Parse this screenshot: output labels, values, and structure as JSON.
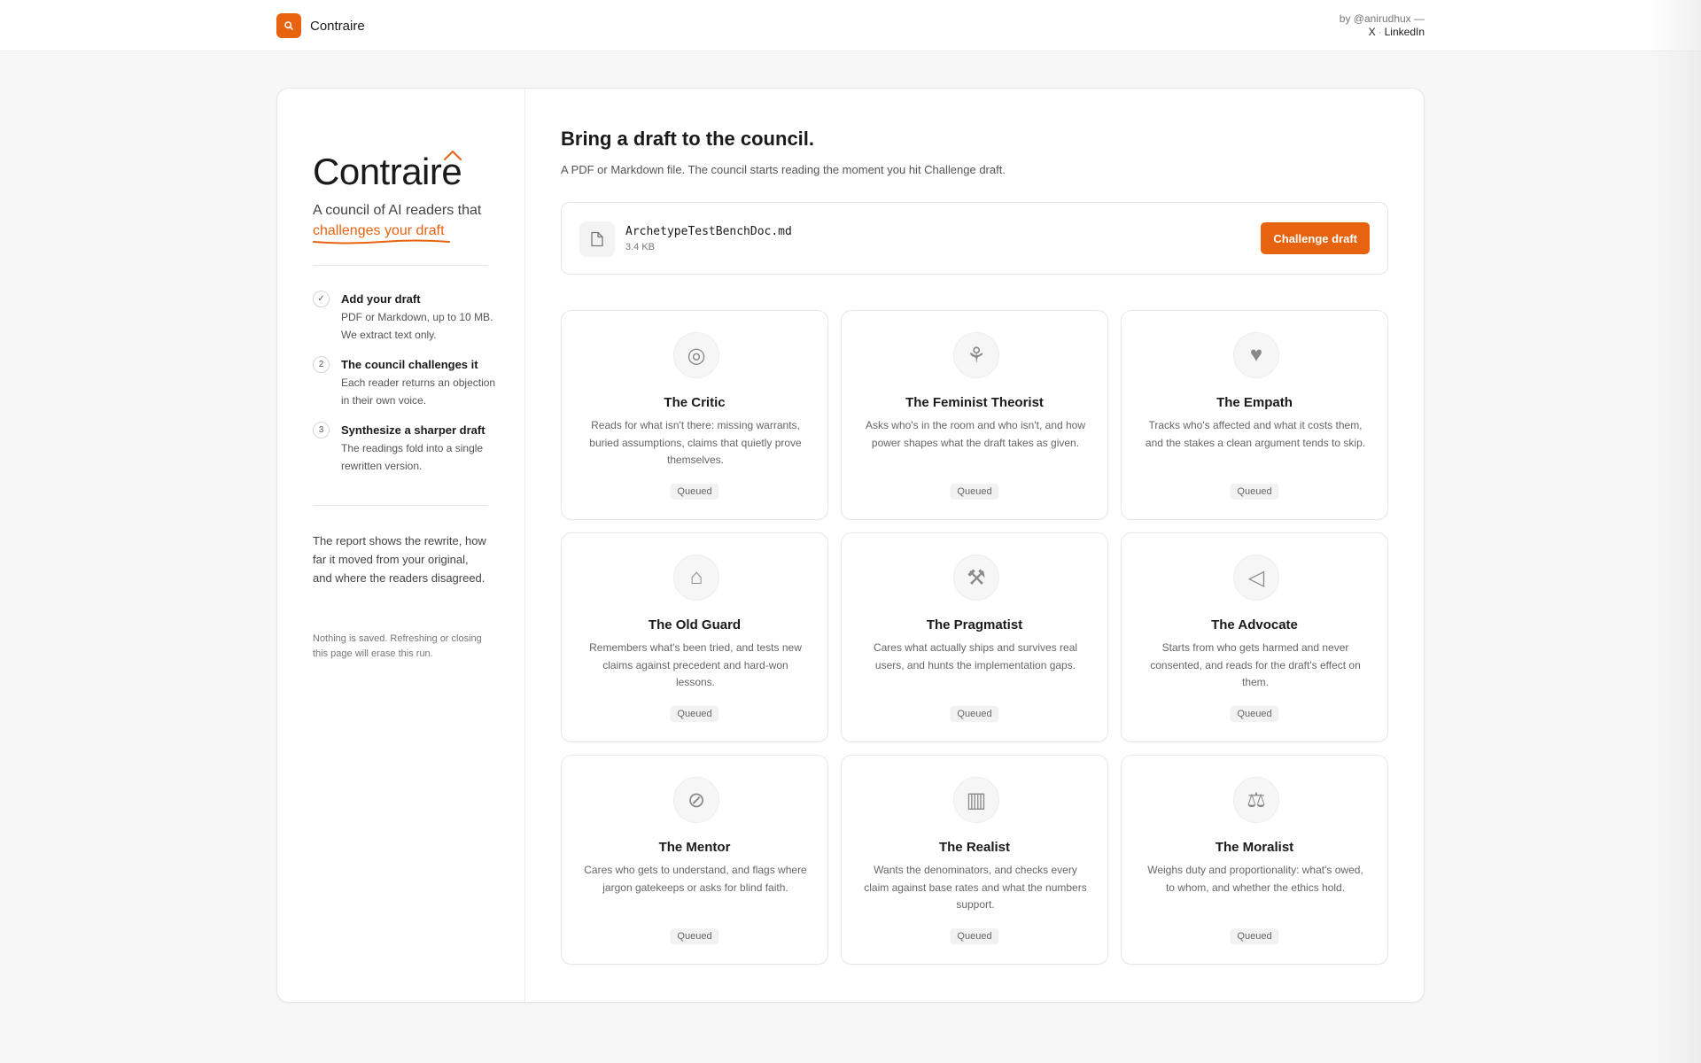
{
  "header": {
    "brand_name": "Contraire",
    "byline_prefix": "by @anirudhux —",
    "links": [
      "X",
      "LinkedIn"
    ],
    "separator": "·"
  },
  "sidebar": {
    "wordmark": "Contraire",
    "tagline_plain": "A council of AI readers that",
    "tagline_accent": "challenges your draft",
    "steps": [
      {
        "marker": "✓",
        "title": "Add your draft",
        "desc": "PDF or Markdown, up to 10 MB. We extract text only."
      },
      {
        "marker": "2",
        "title": "The council challenges it",
        "desc": "Each reader returns an objection in their own voice."
      },
      {
        "marker": "3",
        "title": "Synthesize a sharper draft",
        "desc": "The readings fold into a single rewritten version."
      }
    ],
    "report_text": "The report shows the rewrite, how far it moved from your original, and where the readers disagreed.",
    "note_text": "Nothing is saved. Refreshing or closing this page will erase this run."
  },
  "main": {
    "headline": "Bring a draft to the council.",
    "subhead": "A PDF or Markdown file. The council starts reading the moment you hit Challenge draft.",
    "file": {
      "name": "ArchetypeTestBenchDoc.md",
      "size": "3.4 KB",
      "button_label": "Challenge draft"
    },
    "readers": [
      {
        "icon": "critic-icon",
        "glyph": "◎",
        "name": "The Critic",
        "desc": "Reads for what isn't there: missing warrants, buried assumptions, claims that quietly prove themselves.",
        "status": "Queued"
      },
      {
        "icon": "feminist-theorist-icon",
        "glyph": "⚘",
        "name": "The Feminist Theorist",
        "desc": "Asks who's in the room and who isn't, and how power shapes what the draft takes as given.",
        "status": "Queued"
      },
      {
        "icon": "heart-icon",
        "glyph": "♥",
        "name": "The Empath",
        "desc": "Tracks who's affected and what it costs them, and the stakes a clean argument tends to skip.",
        "status": "Queued"
      },
      {
        "icon": "classical-building-icon",
        "glyph": "⌂",
        "name": "The Old Guard",
        "desc": "Remembers what's been tried, and tests new claims against precedent and hard-won lessons.",
        "status": "Queued"
      },
      {
        "icon": "wrench-icon",
        "glyph": "⚒",
        "name": "The Pragmatist",
        "desc": "Cares what actually ships and survives real users, and hunts the implementation gaps.",
        "status": "Queued"
      },
      {
        "icon": "megaphone-icon",
        "glyph": "◁",
        "name": "The Advocate",
        "desc": "Starts from who gets harmed and never consented, and reads for the draft's effect on them.",
        "status": "Queued"
      },
      {
        "icon": "compass-icon",
        "glyph": "⊘",
        "name": "The Mentor",
        "desc": "Cares who gets to understand, and flags where jargon gatekeeps or asks for blind faith.",
        "status": "Queued"
      },
      {
        "icon": "bar-chart-icon",
        "glyph": "▥",
        "name": "The Realist",
        "desc": "Wants the denominators, and checks every claim against base rates and what the numbers support.",
        "status": "Queued"
      },
      {
        "icon": "scales-icon",
        "glyph": "⚖",
        "name": "The Moralist",
        "desc": "Weighs duty and proportionality: what's owed, to whom, and whether the ethics hold.",
        "status": "Queued"
      }
    ]
  },
  "colors": {
    "accent": "#e8630f",
    "background": "#f7f7f7",
    "card": "#ffffff"
  }
}
